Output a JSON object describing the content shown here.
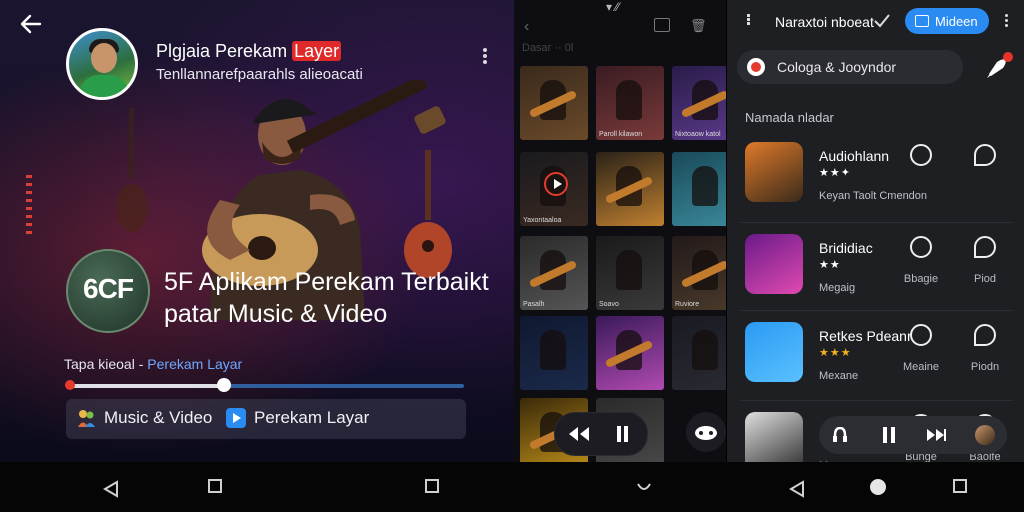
{
  "left": {
    "title_prefix": "Plgjaia Perekam ",
    "title_highlight": "Layer",
    "subtitle": "Tenllannarefpaarahls alieoacati",
    "badge_text": "6CF",
    "headline_line1": "5F Aplikam Perekam Terbaikt",
    "headline_line2": "patar Music & Video",
    "progress_prefix": "Tapa kieoal - ",
    "progress_accent": "Perekam Layar",
    "seek_played_fraction": 0.39,
    "tags": [
      {
        "label": "Music & Video",
        "icon": "music-video-icon",
        "color": "#e8b84a"
      },
      {
        "label": "Perekam Layar",
        "icon": "play-icon",
        "color": "#2a8bf2"
      }
    ]
  },
  "middle": {
    "status": "▾ ⁄⁄",
    "trash": "🗑",
    "faint_text": "Dasar ·· 0l",
    "thumbs": [
      {
        "caption": "",
        "colors": [
          "#3a2a1c",
          "#6a4a2a"
        ]
      },
      {
        "caption": "Paroll kilawon",
        "colors": [
          "#3a1c22",
          "#7a3a3a"
        ]
      },
      {
        "caption": "Nixtoaow katol",
        "colors": [
          "#2a1c4a",
          "#5a3a8a"
        ]
      },
      {
        "caption": "Yaxontaaloa",
        "colors": [
          "#1a1a1e",
          "#3a2a22"
        ]
      },
      {
        "caption": "",
        "colors": [
          "#2a2218",
          "#c08030"
        ]
      },
      {
        "caption": "",
        "colors": [
          "#1a4a5a",
          "#3a8a9a"
        ]
      },
      {
        "caption": "Pasalh",
        "colors": [
          "#2a2a2a",
          "#555555"
        ]
      },
      {
        "caption": "Soavo",
        "colors": [
          "#1a1a1a",
          "#3a3a3a"
        ]
      },
      {
        "caption": "Ruviore",
        "colors": [
          "#221a1a",
          "#4a3a2a"
        ]
      },
      {
        "caption": "",
        "colors": [
          "#101830",
          "#1a2a4a"
        ]
      },
      {
        "caption": "",
        "colors": [
          "#3a1a5a",
          "#b04ab0"
        ]
      },
      {
        "caption": "",
        "colors": [
          "#1a1a22",
          "#2a2a33"
        ]
      },
      {
        "caption": "",
        "colors": [
          "#3a2a0a",
          "#c0901a"
        ]
      },
      {
        "caption": "",
        "colors": [
          "#2a2a2a",
          "#4a4a4a"
        ]
      }
    ]
  },
  "right": {
    "app_title": "Naraxtoi nboeat",
    "pill_label": "Mideen",
    "search_text": "Cologa & Jooyndor",
    "section_title": "Namada nladar",
    "apps": [
      {
        "name": "Audiohlann",
        "stars": "★★✦",
        "star_color": "#ffffff",
        "sub": "Keyan Taolt Cmendon",
        "actions": [
          {
            "label": ""
          },
          {
            "label": ""
          }
        ],
        "icon_colors": [
          "#e07a2a",
          "#3a2a1a"
        ]
      },
      {
        "name": "Brididiac",
        "stars": "★★",
        "star_color": "#ffffff",
        "sub": "Megaig",
        "actions": [
          {
            "label": "Bbagie"
          },
          {
            "label": "Piod"
          }
        ],
        "icon_colors": [
          "#6a1a8a",
          "#e04ab0"
        ]
      },
      {
        "name": "Retkes Pdeanr",
        "stars": "★★★",
        "star_color": "#f0b020",
        "sub": "Mexane",
        "actions": [
          {
            "label": "Meaine"
          },
          {
            "label": "Piodn"
          }
        ],
        "icon_colors": [
          "#2a9af2",
          "#5ac0ff"
        ]
      },
      {
        "name": "",
        "stars": "",
        "star_color": "#ffffff",
        "sub": "Maeasr",
        "actions": [
          {
            "label": "Bunge"
          },
          {
            "label": "Baolfe"
          }
        ],
        "icon_colors": [
          "#e0e0e0",
          "#2a2a2a"
        ]
      }
    ]
  },
  "colors": {
    "accent_blue": "#2a8bf2",
    "accent_red": "#e8342a"
  }
}
